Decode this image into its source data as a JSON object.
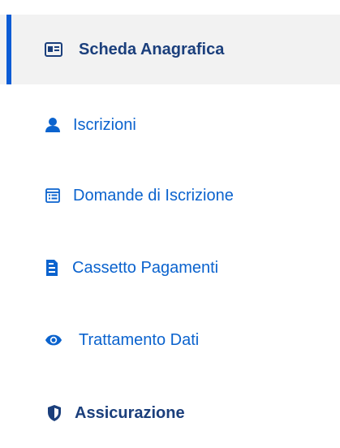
{
  "sidebar": {
    "items": [
      {
        "label": "Scheda Anagrafica",
        "icon": "id-card-icon",
        "active": true
      },
      {
        "label": "Iscrizioni",
        "icon": "user-icon",
        "active": false
      },
      {
        "label": "Domande di Iscrizione",
        "icon": "form-icon",
        "active": false
      },
      {
        "label": "Cassetto Pagamenti",
        "icon": "document-icon",
        "active": false
      },
      {
        "label": "Trattamento Dati",
        "icon": "eye-icon",
        "active": false
      },
      {
        "label": "Assicurazione",
        "icon": "shield-icon",
        "active": false
      }
    ]
  },
  "colors": {
    "accent": "#0b5cd5",
    "link": "#0b63ce",
    "strong": "#1b3f7c",
    "active_background": "#f2f2f2"
  }
}
